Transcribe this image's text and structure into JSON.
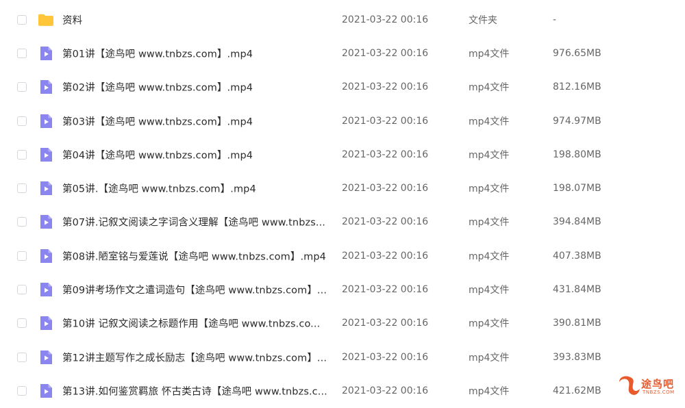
{
  "colors": {
    "folder": "#ffc63b",
    "video_icon": "#8b85f0",
    "text": "#2b2b2b",
    "meta": "#666666",
    "watermark": "#e85a2c"
  },
  "files": [
    {
      "icon": "folder-icon",
      "name": "资料",
      "date": "2021-03-22 00:16",
      "type": "文件夹",
      "size": "-"
    },
    {
      "icon": "video-file-icon",
      "name": "第01讲【途鸟吧 www.tnbzs.com】.mp4",
      "date": "2021-03-22 00:16",
      "type": "mp4文件",
      "size": "976.65MB"
    },
    {
      "icon": "video-file-icon",
      "name": "第02讲【途鸟吧 www.tnbzs.com】.mp4",
      "date": "2021-03-22 00:16",
      "type": "mp4文件",
      "size": "812.16MB"
    },
    {
      "icon": "video-file-icon",
      "name": "第03讲【途鸟吧 www.tnbzs.com】.mp4",
      "date": "2021-03-22 00:16",
      "type": "mp4文件",
      "size": "974.97MB"
    },
    {
      "icon": "video-file-icon",
      "name": "第04讲【途鸟吧 www.tnbzs.com】.mp4",
      "date": "2021-03-22 00:16",
      "type": "mp4文件",
      "size": "198.80MB"
    },
    {
      "icon": "video-file-icon",
      "name": "第05讲.【途鸟吧 www.tnbzs.com】.mp4",
      "date": "2021-03-22 00:16",
      "type": "mp4文件",
      "size": "198.07MB"
    },
    {
      "icon": "video-file-icon",
      "name": "第07讲.记叙文阅读之字词含义理解【途鸟吧 www.tnbzs...",
      "date": "2021-03-22 00:16",
      "type": "mp4文件",
      "size": "394.84MB"
    },
    {
      "icon": "video-file-icon",
      "name": "第08讲.陋室铭与爱莲说【途鸟吧 www.tnbzs.com】.mp4",
      "date": "2021-03-22 00:16",
      "type": "mp4文件",
      "size": "407.38MB"
    },
    {
      "icon": "video-file-icon",
      "name": "第09讲考场作文之遣词造句【途鸟吧 www.tnbzs.com】...",
      "date": "2021-03-22 00:16",
      "type": "mp4文件",
      "size": "431.84MB"
    },
    {
      "icon": "video-file-icon",
      "name": "第10讲 记叙文阅读之标题作用【途鸟吧 www.tnbzs.co...",
      "date": "2021-03-22 00:16",
      "type": "mp4文件",
      "size": "390.81MB"
    },
    {
      "icon": "video-file-icon",
      "name": "第12讲主题写作之成长励志【途鸟吧 www.tnbzs.com】...",
      "date": "2021-03-22 00:16",
      "type": "mp4文件",
      "size": "393.83MB"
    },
    {
      "icon": "video-file-icon",
      "name": "第13讲.如何鉴赏羁旅 怀古类古诗【途鸟吧 www.tnbzs.c...",
      "date": "2021-03-22 00:16",
      "type": "mp4文件",
      "size": "421.62MB"
    }
  ],
  "watermark": {
    "text": "途鸟吧",
    "sub": "TNBZS.COM"
  }
}
